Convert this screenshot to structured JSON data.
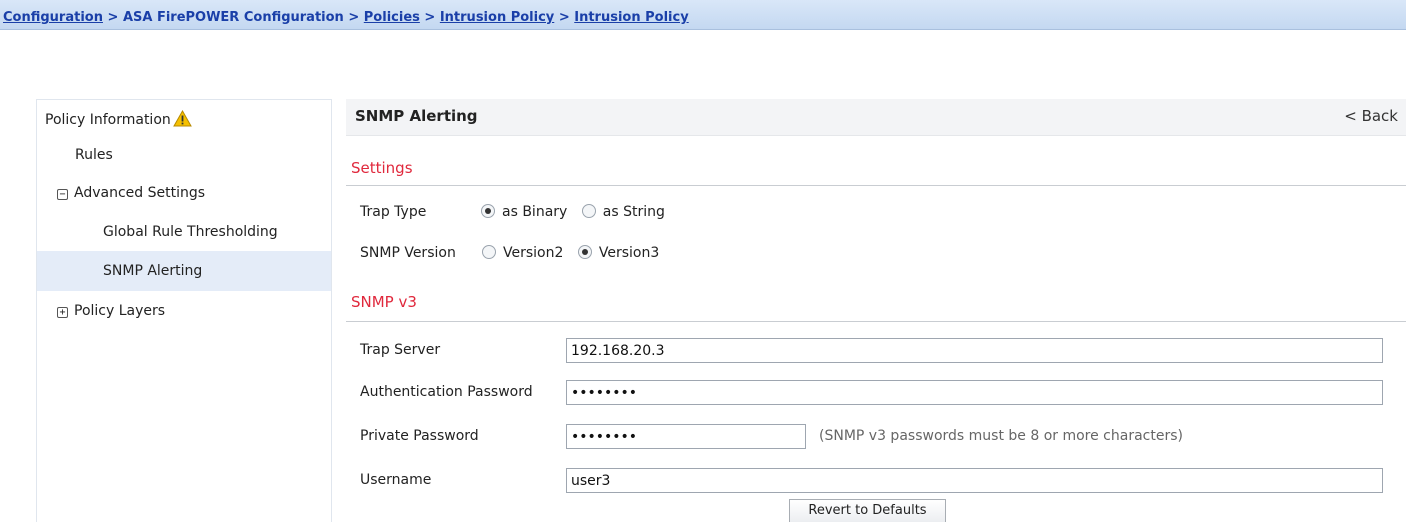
{
  "breadcrumb": {
    "items": [
      "Configuration",
      "ASA FirePOWER Configuration",
      "Policies",
      "Intrusion Policy",
      "Intrusion Policy"
    ],
    "separator": ">"
  },
  "sidebar": {
    "policy_information": "Policy Information",
    "rules": "Rules",
    "advanced_settings": "Advanced Settings",
    "advanced_toggle": "⊟",
    "global_rule_thresholding": "Global Rule Thresholding",
    "snmp_alerting": "SNMP Alerting",
    "policy_layers": "Policy Layers",
    "policy_layers_toggle": "⊞",
    "warning_icon": "warning-triangle-icon"
  },
  "content": {
    "title": "SNMP Alerting",
    "back": "< Back"
  },
  "settings": {
    "section_title": "Settings",
    "trap_type_label": "Trap Type",
    "trap_type_options": [
      "as Binary",
      "as String"
    ],
    "trap_type_selected": "as Binary",
    "snmp_version_label": "SNMP Version",
    "snmp_version_options": [
      "Version2",
      "Version3"
    ],
    "snmp_version_selected": "Version3"
  },
  "snmpv3": {
    "section_title": "SNMP v3",
    "trap_server_label": "Trap Server",
    "trap_server_value": "192.168.20.3",
    "auth_password_label": "Authentication Password",
    "auth_password_value": "••••••••",
    "private_password_label": "Private Password",
    "private_password_value": "••••••••",
    "password_hint": "(SNMP v3 passwords must be 8 or more characters)",
    "username_label": "Username",
    "username_value": "user3"
  },
  "actions": {
    "revert": "Revert to Defaults"
  },
  "colors": {
    "section_title": "#e0283c",
    "breadcrumb_link": "#1a3fa8",
    "active_sidebar_bg": "#e4ecf8"
  }
}
